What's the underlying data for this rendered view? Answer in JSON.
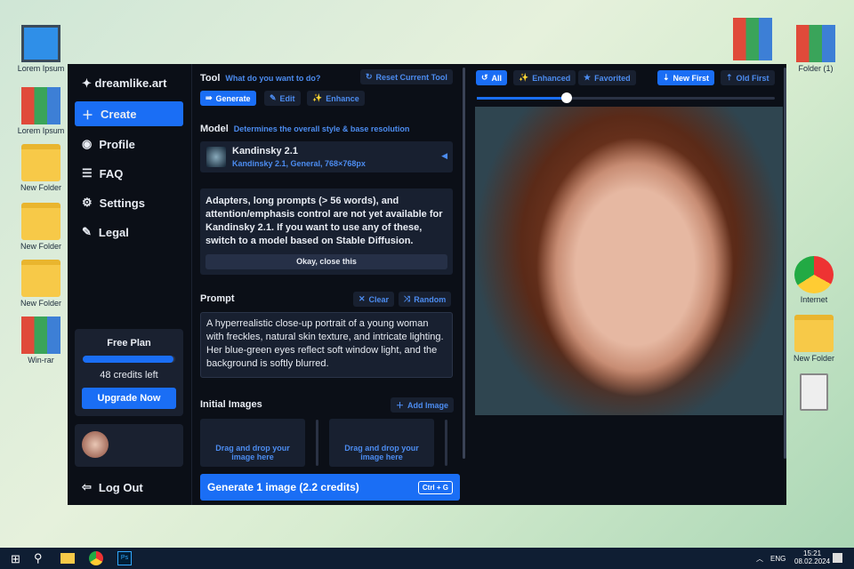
{
  "desktop": {
    "left": [
      "Lorem Ipsum",
      "Lorem Ipsum",
      "New Folder",
      "New Folder",
      "New Folder",
      "Win-rar"
    ],
    "right": [
      "",
      "Folder (1)",
      "Internet",
      "New Folder",
      ""
    ]
  },
  "sidebar": {
    "brand": "dreamlike.art",
    "items": [
      "Create",
      "Profile",
      "FAQ",
      "Settings",
      "Legal"
    ],
    "plan": "Free Plan",
    "credits": "48 credits left",
    "credits_fraction": 0.98,
    "upgrade": "Upgrade Now",
    "logout": "Log Out"
  },
  "tool": {
    "label": "Tool",
    "hint": "What do you want to do?",
    "reset": "Reset Current Tool",
    "tabs": [
      "Generate",
      "Edit",
      "Enhance"
    ]
  },
  "model": {
    "label": "Model",
    "hint": "Determines the overall style & base resolution",
    "name": "Kandinsky 2.1",
    "details": "Kandinsky 2.1, General, 768×768px"
  },
  "notice": {
    "text": "Adapters, long prompts (> 56 words), and attention/emphasis control are not yet available for Kandinsky 2.1. If you want to use any of these, switch to a model based on Stable Diffusion.",
    "button": "Okay, close this"
  },
  "prompt": {
    "label": "Prompt",
    "clear": "Clear",
    "random": "Random",
    "value": "A hyperrealistic close-up portrait of a young woman with freckles, natural skin texture, and intricate lighting. Her blue-green eyes reflect soft window light, and the background is softly blurred."
  },
  "initial": {
    "label": "Initial Images",
    "add": "Add Image",
    "drop": "Drag and drop your image here"
  },
  "generate": {
    "label": "Generate 1 image (2.2 credits)",
    "shortcut": "Ctrl + G"
  },
  "gallery": {
    "filters": [
      "All",
      "Enhanced",
      "Favorited"
    ],
    "sort": [
      "New First",
      "Old First"
    ],
    "zoom_fraction": 0.3
  },
  "taskbar": {
    "lang": "ENG",
    "time": "15:21",
    "date": "08.02.2024"
  }
}
